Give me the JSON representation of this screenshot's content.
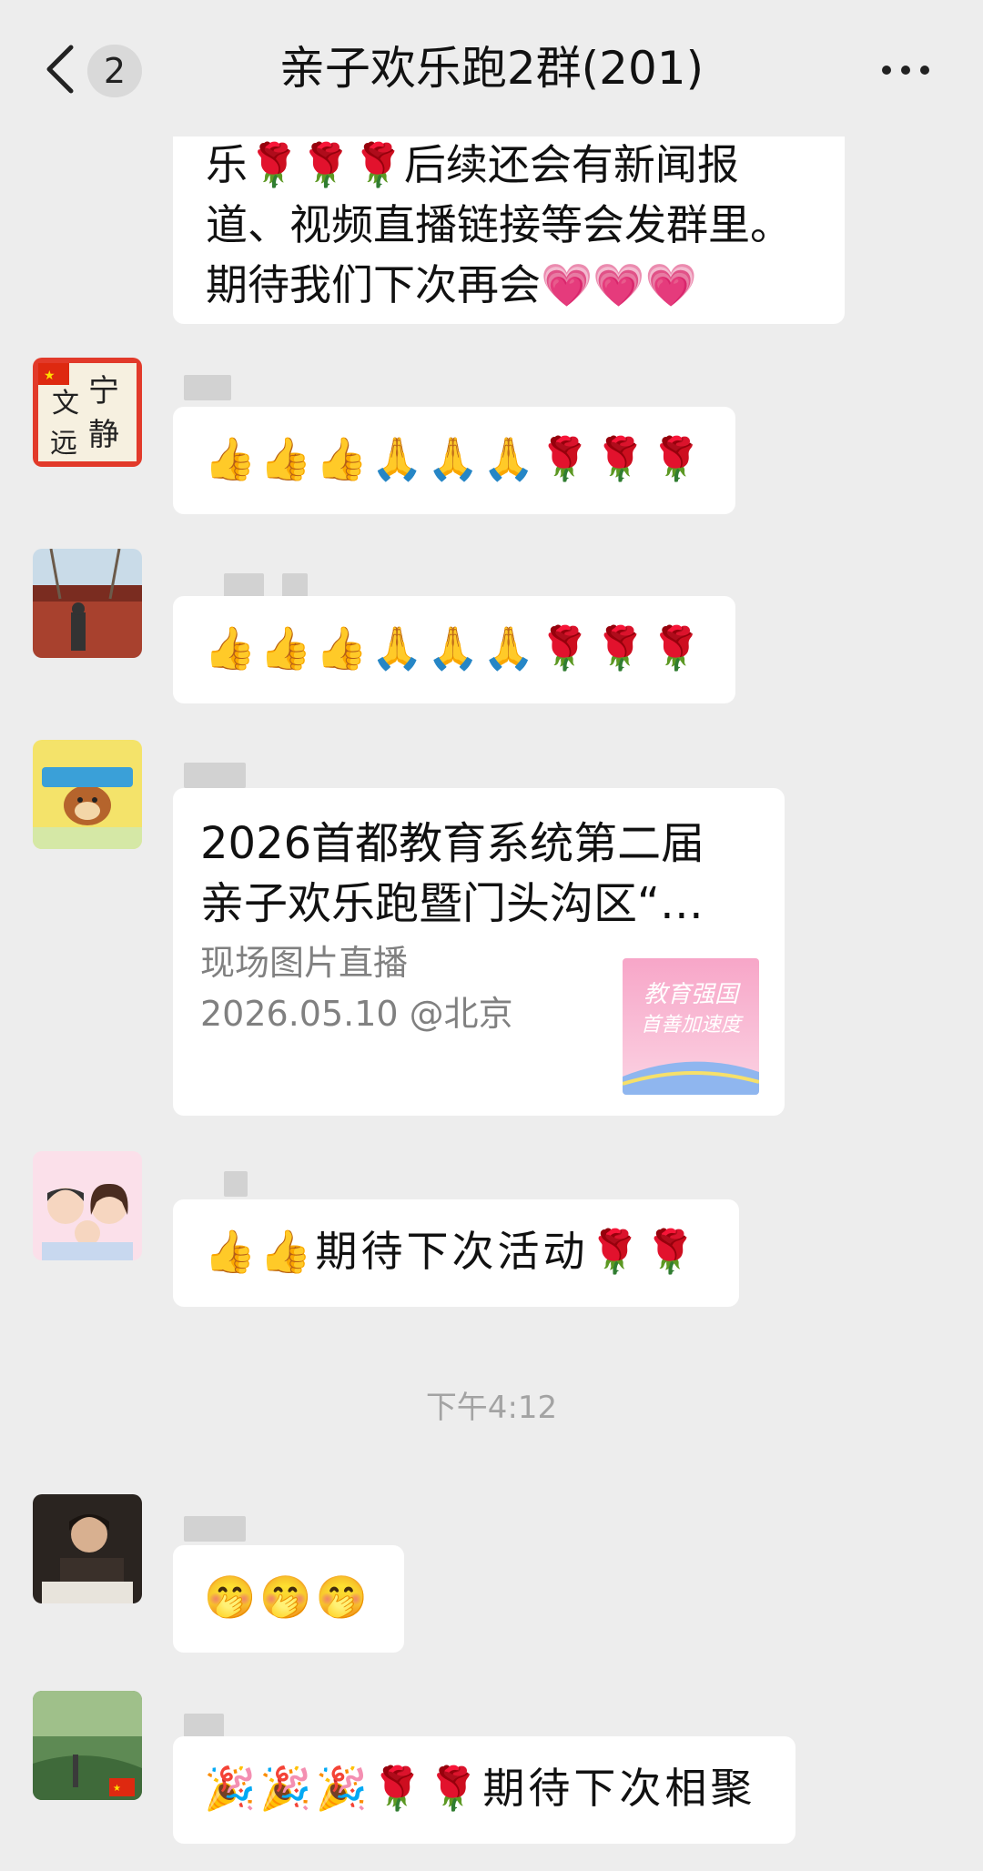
{
  "header": {
    "title": "亲子欢乐跑2群(201)",
    "unread_count": "2",
    "back_icon": "chevron-left-icon",
    "more_icon": "ellipsis-icon"
  },
  "messages": {
    "m0": {
      "lines": [
        "乐🌹🌹🌹后续还会有新闻报",
        "道、视频直播链接等会发群里。",
        "期待我们下次再会💗💗💗"
      ]
    },
    "m1": {
      "text": "👍👍👍🙏🙏🙏🌹🌹🌹"
    },
    "m2": {
      "text": "👍👍👍🙏🙏🙏🌹🌹🌹"
    },
    "m3": {
      "title_lines": [
        "2026首都教育系统第二届",
        "亲子欢乐跑暨门头沟区“…"
      ],
      "desc_lines": [
        "现场图片直播",
        "2026.05.10 @北京"
      ],
      "thumb_text_1": "教育强国",
      "thumb_text_2": "首善加速度"
    },
    "m4": {
      "text": "👍👍期待下次活动🌹🌹"
    },
    "timestamp": "下午4:12",
    "m5": {
      "text": "🤭🤭🤭"
    },
    "m6": {
      "text": "🎉🎉🎉🌹🌹期待下次相聚"
    }
  },
  "avatars": {
    "a1_text": [
      "宁",
      "文",
      "静",
      "远"
    ]
  },
  "colors": {
    "background": "#ededed",
    "bubble": "#ffffff"
  }
}
